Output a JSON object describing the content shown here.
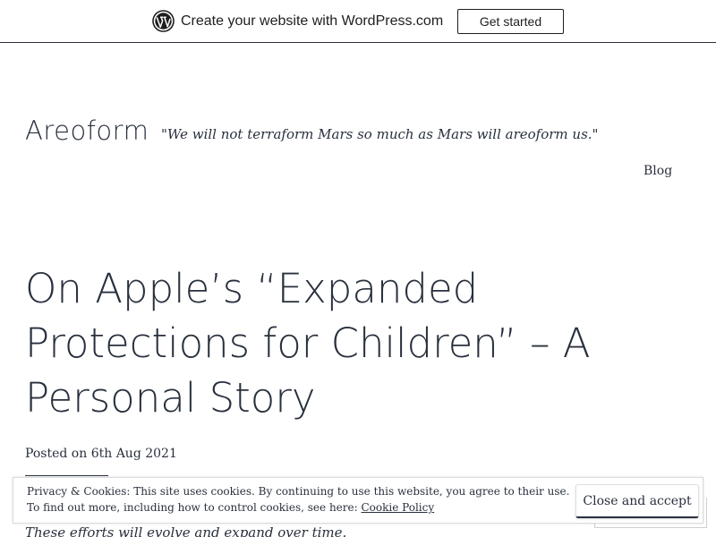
{
  "wp_banner": {
    "text": "Create your website with WordPress.com",
    "cta_label": "Get started",
    "logo_icon": "wordpress-logo-icon"
  },
  "site": {
    "title": "Areoform",
    "tagline": "\"We will not terraform Mars so much as Mars will areoform us.\"",
    "nav": [
      {
        "label": "Blog"
      }
    ]
  },
  "post": {
    "title": "On Apple’s “Expanded Protections for Children” – A Personal Story",
    "meta_prefix": "Posted on",
    "date": "6th Aug 2021",
    "excerpt": "These efforts will evolve and expand over time."
  },
  "cookie_notice": {
    "line1": "Privacy & Cookies: This site uses cookies. By continuing to use this website, you agree to their use.",
    "line2_prefix": "To find out more, including how to control cookies, see here:",
    "link_label": "Cookie Policy",
    "accept_label": "Close and accept"
  },
  "colors": {
    "text": "#28303d",
    "background": "#ffffff"
  }
}
